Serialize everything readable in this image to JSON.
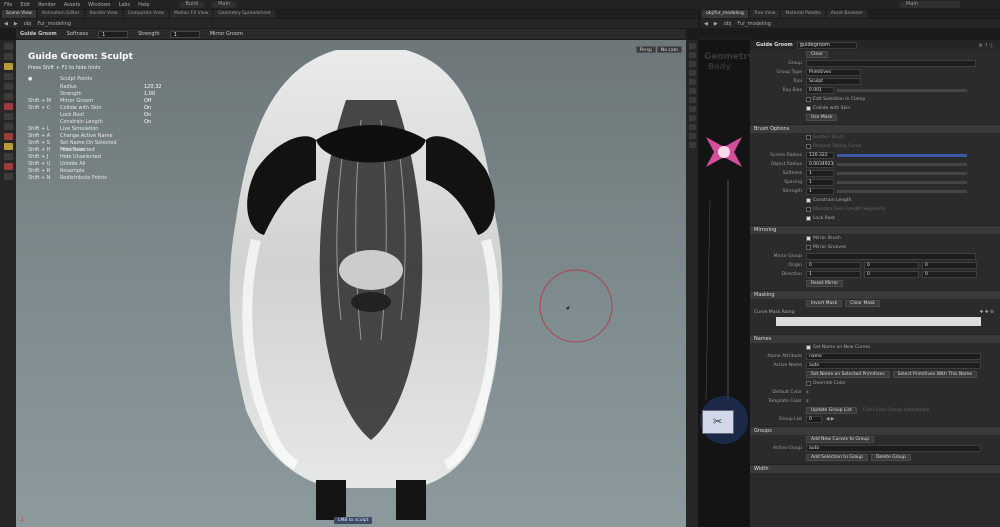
{
  "menubar": {
    "items": [
      "File",
      "Edit",
      "Render",
      "Assets",
      "Windows",
      "Labs",
      "Help"
    ],
    "build": "Build",
    "main1": "Main",
    "main2": "Main"
  },
  "tabs_left": [
    "Scene View",
    "Animation Editor",
    "Render View",
    "Composite View",
    "Motion FX View",
    "Geometry Spreadsheet"
  ],
  "tabs_right": [
    "obj/fur_modeling",
    "Tree View",
    "Material Palette",
    "Asset Browser"
  ],
  "path_left": {
    "obj": "obj",
    "node": "Fur_modeling"
  },
  "path_right": {
    "obj": "obj",
    "node": "Fur_modeling"
  },
  "context_bar": {
    "title": "Guide Groom",
    "softness_label": "Softness",
    "softness": "1",
    "strength_label": "Strength",
    "strength": "1",
    "mirror_label": "Mirror Groom"
  },
  "viewport": {
    "overlay_title": "Guide Groom: Sculpt",
    "hint": "Press Shift + F1 to hide hints",
    "brush": "Sculpt Points",
    "params": [
      {
        "label": "Radius",
        "value": "120.32"
      },
      {
        "label": "Strength",
        "value": "1.00"
      }
    ],
    "hotkeys": [
      {
        "key": "Shift + M",
        "label": "Mirror Groom",
        "value": "Off"
      },
      {
        "key": "Shift + C",
        "label": "Collide with Skin",
        "value": "On"
      },
      {
        "key": "",
        "label": "Lock Root",
        "value": "On"
      },
      {
        "key": "",
        "label": "Constrain Length",
        "value": "On"
      },
      {
        "key": "Shift + L",
        "label": "Live Simulation",
        "value": ""
      },
      {
        "key": "Shift + A",
        "label": "Change Active Name",
        "value": ""
      },
      {
        "key": "Shift + S",
        "label": "Set Name On Selected Primitives",
        "value": ""
      },
      {
        "key": "Shift + H",
        "label": "Hide Selected",
        "value": ""
      },
      {
        "key": "Shift + J",
        "label": "Hide Unselected",
        "value": ""
      },
      {
        "key": "Shift + U",
        "label": "Unhide All",
        "value": ""
      },
      {
        "key": "Shift + R",
        "label": "Resample",
        "value": ""
      },
      {
        "key": "Shift + N",
        "label": "Redistribute Points",
        "value": ""
      }
    ],
    "persp": "Persp",
    "cam": "No cam",
    "bottom_label": "LMB to sculpt"
  },
  "network": {
    "title": "Geometry",
    "sub": "Body"
  },
  "params_panel": {
    "header": "Guide Groom",
    "path": "guidegroom",
    "clear": "Clear",
    "group_label": "Group",
    "group_type_label": "Group Type",
    "group_type": "Primitives",
    "tool_label": "Tool",
    "tool": "Sculpt",
    "ray_bias_label": "Ray Bias",
    "ray_bias": "0.001",
    "edit_sel": "Edit Selection in Clamp",
    "collide": "Collide with Skin",
    "use_mask": "Use Mask",
    "brush_options": "Brush Options",
    "surface_brush": "Surface Brush",
    "respect_falloff": "Respect Falling Curve",
    "screen_radius_label": "Screen Radius",
    "screen_radius": "120.322",
    "object_radius_label": "Object Radius",
    "object_radius": "0.0034923",
    "softness_label": "Softness",
    "softness": "1",
    "spacing_label": "Spacing",
    "spacing": "1",
    "strength_label": "Strength",
    "strength": "1",
    "constrain_length": "Constrain Length",
    "maintain_seg": "Maintain Even Length Segments",
    "lock_root": "Lock Root",
    "mirroring": "Mirroring",
    "mirror_brush": "Mirror Brush",
    "mirror_grooves": "Mirror Grooves",
    "mirror_group_label": "Mirror Group",
    "origin_label": "Origin",
    "origin": [
      "0",
      "0",
      "0"
    ],
    "direction_label": "Direction",
    "direction": [
      "1",
      "0",
      "0"
    ],
    "reset_mirror": "Reset Mirror",
    "masking": "Masking",
    "invert_mask": "Invert Mask",
    "clear_mask": "Clear Mask",
    "curve_mask_ramp": "Curve Mask Ramp",
    "names": "Names",
    "set_name": "Set Name on New Curves",
    "name_attr_label": "Name Attribute",
    "name_attr": "name",
    "active_name_label": "Active Name",
    "active_name": "auto",
    "set_name_sel": "Set Name on Selected Primitives",
    "select_prim": "Select Primitives With This Name",
    "override_color": "Override Color",
    "default_color": "Default Color",
    "template_color": "Template Color",
    "update_group_list": "Update Group List",
    "color_each": "Color Each Group Individually",
    "group_list_label": "Group List",
    "group_list": "0",
    "groups": "Groups",
    "add_new_curves": "Add New Curves to Group",
    "active_group_label": "Active Group",
    "active_group": "auto",
    "add_sel": "Add Selection to Group",
    "delete_group": "Delete Group",
    "width": "Width"
  }
}
